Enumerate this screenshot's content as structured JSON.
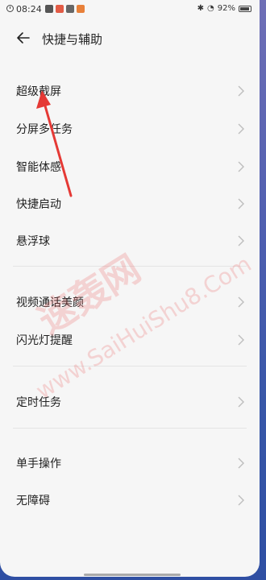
{
  "status_bar": {
    "time": "08:24",
    "battery": "92%"
  },
  "header": {
    "title": "快捷与辅助"
  },
  "groups": [
    {
      "items": [
        "超级截屏",
        "分屏多任务",
        "智能体感",
        "快捷启动",
        "悬浮球"
      ]
    },
    {
      "items": [
        "视频通话美颜",
        "闪光灯提醒"
      ]
    },
    {
      "items": [
        "定时任务"
      ]
    },
    {
      "items": [
        "单手操作",
        "无障碍"
      ]
    }
  ],
  "watermark": {
    "cn": "速轰网",
    "en": "www.SaiHuiShu8.Com"
  },
  "colors": {
    "annotation_arrow": "#e53935",
    "background": "#f6f6f6",
    "text": "#222222",
    "chevron": "#bdbdbd"
  }
}
